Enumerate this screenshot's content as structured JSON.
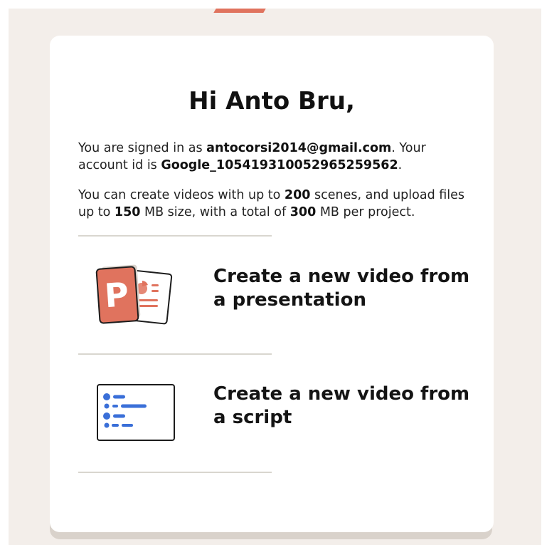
{
  "greeting": "Hi Anto Bru,",
  "account": {
    "signed_in_prefix": "You are signed in as ",
    "email": "antocorsi2014@gmail.com",
    "id_prefix": ". Your account id is ",
    "account_id": "Google_105419310052965259562",
    "id_suffix": "."
  },
  "limits": {
    "t1": "You can create videos with up to ",
    "max_scenes": "200",
    "t2": " scenes, and upload files up to ",
    "max_file_size": "150",
    "t3": " MB size, with a total of ",
    "max_project_size": "300",
    "t4": " MB per project."
  },
  "options": [
    {
      "label": "Create a new video from a presentation",
      "icon": "presentation-icon"
    },
    {
      "label": "Create a new video from a script",
      "icon": "script-icon"
    }
  ],
  "colors": {
    "background": "#f3eeea",
    "accent": "#e0735e",
    "script_icon_blue": "#3a6fd8"
  }
}
